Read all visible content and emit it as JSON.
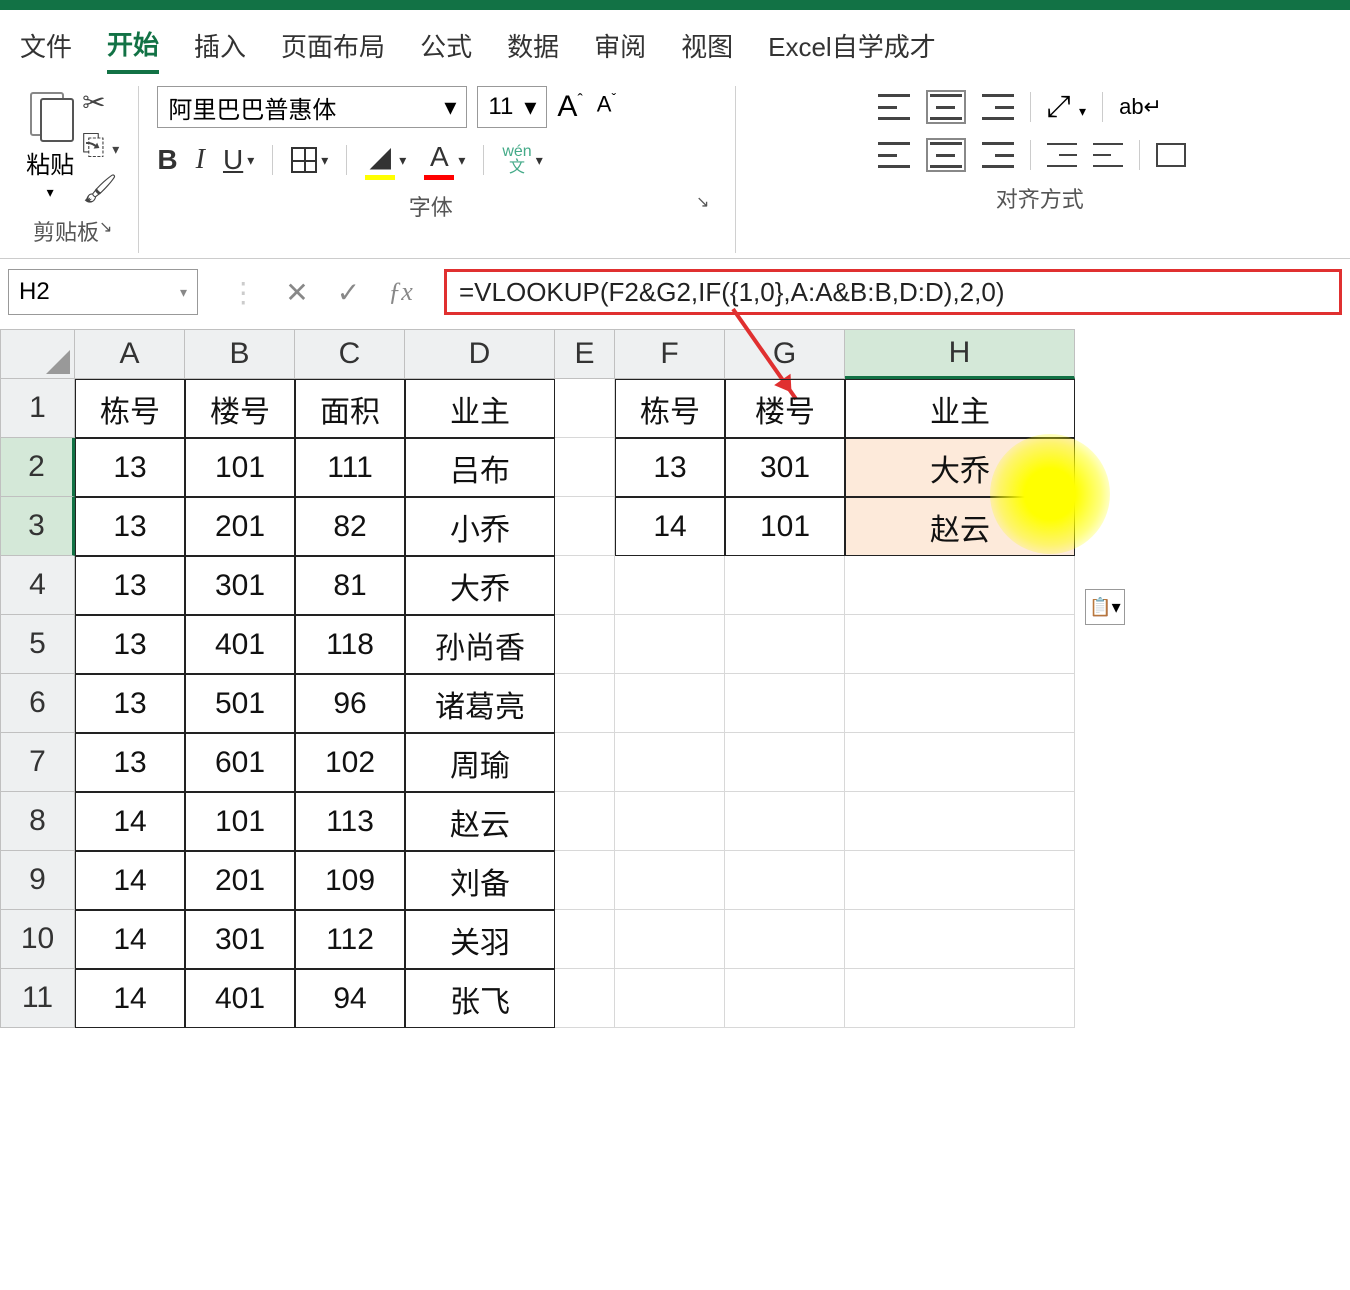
{
  "tabs": {
    "file": "文件",
    "home": "开始",
    "insert": "插入",
    "pagelayout": "页面布局",
    "formulas": "公式",
    "data": "数据",
    "review": "审阅",
    "view": "视图",
    "excel_self": "Excel自学成才"
  },
  "ribbon": {
    "paste": "粘贴",
    "clipboard_label": "剪贴板",
    "font_name": "阿里巴巴普惠体",
    "font_size": "11",
    "bold": "B",
    "italic": "I",
    "underline": "U",
    "font_color": "A",
    "wen_top": "wén",
    "wen_bottom": "文",
    "font_label": "字体",
    "align_label": "对齐方式",
    "wrap": "ab↵"
  },
  "formula_bar": {
    "name_box": "H2",
    "formula": "=VLOOKUP(F2&G2,IF({1,0},A:A&B:B,D:D),2,0)"
  },
  "columns": [
    "A",
    "B",
    "C",
    "D",
    "E",
    "F",
    "G",
    "H"
  ],
  "rows": [
    "1",
    "2",
    "3",
    "4",
    "5",
    "6",
    "7",
    "8",
    "9",
    "10",
    "11"
  ],
  "sheet": {
    "headers_left": {
      "A": "栋号",
      "B": "楼号",
      "C": "面积",
      "D": "业主"
    },
    "headers_right": {
      "F": "栋号",
      "G": "楼号",
      "H": "业主"
    },
    "data": [
      {
        "A": "13",
        "B": "101",
        "C": "111",
        "D": "吕布",
        "F": "13",
        "G": "301",
        "H": "大乔"
      },
      {
        "A": "13",
        "B": "201",
        "C": "82",
        "D": "小乔",
        "F": "14",
        "G": "101",
        "H": "赵云"
      },
      {
        "A": "13",
        "B": "301",
        "C": "81",
        "D": "大乔"
      },
      {
        "A": "13",
        "B": "401",
        "C": "118",
        "D": "孙尚香"
      },
      {
        "A": "13",
        "B": "501",
        "C": "96",
        "D": "诸葛亮"
      },
      {
        "A": "13",
        "B": "601",
        "C": "102",
        "D": "周瑜"
      },
      {
        "A": "14",
        "B": "101",
        "C": "113",
        "D": "赵云"
      },
      {
        "A": "14",
        "B": "201",
        "C": "109",
        "D": "刘备"
      },
      {
        "A": "14",
        "B": "301",
        "C": "112",
        "D": "关羽"
      },
      {
        "A": "14",
        "B": "401",
        "C": "94",
        "D": "张飞"
      }
    ]
  }
}
